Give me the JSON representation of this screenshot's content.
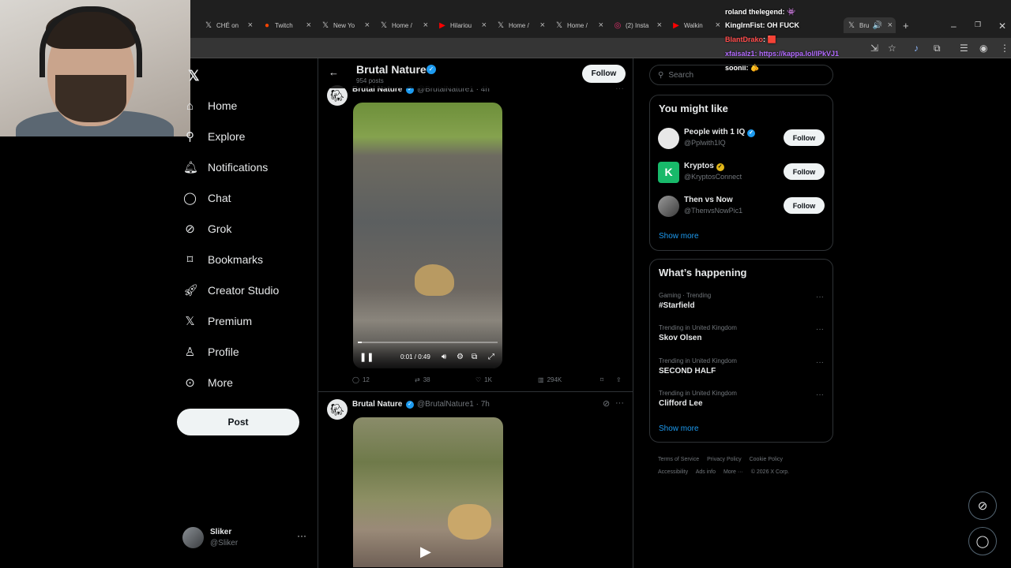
{
  "browser": {
    "tabs": [
      {
        "label": "CHÉ on",
        "icon": "x-icon"
      },
      {
        "label": "Twitch",
        "icon": "reddit-icon"
      },
      {
        "label": "New Yo",
        "icon": "x-icon"
      },
      {
        "label": "Home /",
        "icon": "x-icon"
      },
      {
        "label": "Hilariou",
        "icon": "youtube-icon"
      },
      {
        "label": "Home /",
        "icon": "x-icon"
      },
      {
        "label": "Home /",
        "icon": "x-icon"
      },
      {
        "label": "(2) Insta",
        "icon": "instagram-icon"
      },
      {
        "label": "Walkin",
        "icon": "youtube-icon"
      },
      {
        "label": "Bru",
        "icon": "x-icon"
      }
    ],
    "new_tab": "+"
  },
  "chat": [
    {
      "user": "roland thelegend",
      "msg": ": 👾",
      "color": "#ffffff"
    },
    {
      "user": "KingIrnFist",
      "msg": ": OH FUCK",
      "color": "#ffffff"
    },
    {
      "user": "BlantDrako",
      "msg": ": 🟥",
      "color": "#ff4b4b"
    },
    {
      "user": "xfaisalz1",
      "msg": ": https://kappa.lol/lPkVJ1",
      "color": "#b36bff"
    },
    {
      "user": "soonii",
      "msg": ": 🫵",
      "color": "#ffffff"
    }
  ],
  "nav": {
    "items": [
      {
        "label": "Home",
        "icon": "home-icon"
      },
      {
        "label": "Explore",
        "icon": "search-icon"
      },
      {
        "label": "Notifications",
        "icon": "bell-icon"
      },
      {
        "label": "Chat",
        "icon": "chat-icon"
      },
      {
        "label": "Grok",
        "icon": "grok-icon"
      },
      {
        "label": "Bookmarks",
        "icon": "bookmark-icon"
      },
      {
        "label": "Creator Studio",
        "icon": "rocket-icon"
      },
      {
        "label": "Premium",
        "icon": "x-icon"
      },
      {
        "label": "Profile",
        "icon": "person-icon"
      },
      {
        "label": "More",
        "icon": "more-circle-icon"
      }
    ],
    "post_label": "Post"
  },
  "account": {
    "name": "Sliker",
    "handle": "@Sliker"
  },
  "profile_header": {
    "name": "Brutal Nature",
    "posts": "954 posts",
    "follow_label": "Follow"
  },
  "tweets": [
    {
      "name": "Brutal Nature",
      "handle": "@BrutalNature1 · 4h",
      "video_time": "0:01 / 0:49",
      "video_progress": 0.03,
      "replies": "12",
      "reposts": "38",
      "likes": "1K",
      "views": "294K"
    },
    {
      "name": "Brutal Nature",
      "handle": "@BrutalNature1 · 7h"
    }
  ],
  "sidebar": {
    "search_placeholder": "Search",
    "you_might_like": {
      "title": "You might like",
      "items": [
        {
          "name": "People with 1 IQ",
          "handle": "@Pplwith1IQ",
          "badge": "#1d9bf0"
        },
        {
          "name": "Kryptos",
          "handle": "@KryptosConnect",
          "badge": "#e2b719"
        },
        {
          "name": "Then vs Now",
          "handle": "@ThenvsNowPic1"
        }
      ],
      "follow_label": "Follow",
      "show_more": "Show more"
    },
    "whats_happening": {
      "title": "What’s happening",
      "items": [
        {
          "context": "Gaming · Trending",
          "name": "#Starfield"
        },
        {
          "context": "Trending in United Kingdom",
          "name": "Skov Olsen"
        },
        {
          "context": "Trending in United Kingdom",
          "name": "SECOND HALF"
        },
        {
          "context": "Trending in United Kingdom",
          "name": "Clifford Lee"
        }
      ],
      "show_more": "Show more"
    },
    "footer": [
      "Terms of Service",
      "Privacy Policy",
      "Cookie Policy",
      "Accessibility",
      "Ads info",
      "More ···",
      "© 2026 X Corp."
    ]
  }
}
